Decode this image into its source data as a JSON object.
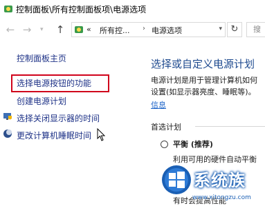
{
  "window": {
    "title": "控制面板\\所有控制面板项\\电源选项"
  },
  "navigation": {
    "back_icon": "arrow-left-icon",
    "forward_icon": "arrow-right-icon",
    "up_icon": "arrow-up-icon",
    "address_overflow": "«",
    "address_segments": [
      "所有控...",
      "电源选项"
    ],
    "search_placeholder": "搜"
  },
  "sidebar": {
    "home": "控制面板主页",
    "items": [
      {
        "label": "选择电源按钮的功能",
        "highlighted": true
      },
      {
        "label": "创建电源计划"
      },
      {
        "label": "选择关闭显示器的时间",
        "icon": "monitor-shield-icon"
      },
      {
        "label": "更改计算机睡眠时间",
        "icon": "moon-sleep-icon"
      }
    ]
  },
  "main": {
    "title": "选择或自定义电源计划",
    "description_lines": [
      "电源计划是用于管理计算机如何",
      "设置(如显示器亮度、睡眠等)。"
    ],
    "more_link": "信息",
    "section_label": "首选计划",
    "plans": [
      {
        "name": "平衡 (推荐)",
        "description": "利用可用的硬件自动平衡"
      },
      {
        "name": "",
        "description": "有时会提高性能"
      }
    ]
  },
  "watermark": {
    "text": "系统族",
    "url": "www.xitongzu.com"
  },
  "colors": {
    "link": "#1e3287",
    "title_blue": "#1e4a8f",
    "highlight_red": "#d0021b"
  }
}
